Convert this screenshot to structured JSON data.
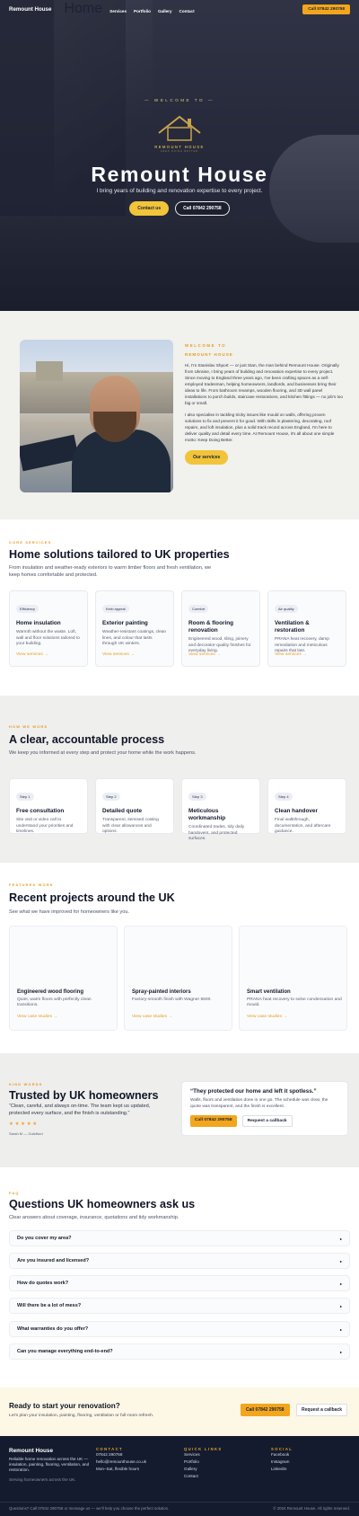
{
  "nav": {
    "brand": "Remount House",
    "links": [
      "Home",
      "Services",
      "Portfolio",
      "Gallery",
      "Contact"
    ],
    "cta": "Call 07842 290758"
  },
  "hero": {
    "kicker": "WELCOME TO",
    "logo_text": "REMOUNT HOUSE",
    "logo_tag": "KEEP DOING BETTER",
    "title": "Remount House",
    "subtitle": "I bring years of building and renovation expertise to every project.",
    "btn_primary": "Contact us",
    "btn_secondary": "Call 07842 290758"
  },
  "about": {
    "kicker": "WELCOME TO",
    "name": "REMOUNT HOUSE",
    "p1": "Hi, I'm Stanislav Shport — or just Stan, the man behind Remount House. Originally from Ukraine, I bring years of building and renovation expertise to every project. Since moving to England three years ago, I've been crafting spaces as a self-employed tradesman, helping homeowners, landlords, and businesses bring their ideas to life. From bathroom revamps, wooden flooring, and 3D wall panel installations to porch builds, staircase restorations, and kitchen fittings — no job's too big or small.",
    "p2": "I also specialise in tackling tricky issues like mould on walls, offering proven solutions to fix and prevent it for good. With skills in plastering, decorating, roof repairs, and loft insulation, plus a solid track record across England, I'm here to deliver quality and detail every time. At Remount House, it's all about one simple motto: Keep Doing Better.",
    "button": "Our services"
  },
  "services": {
    "kicker": "CORE SERVICES",
    "title": "Home solutions tailored to UK properties",
    "desc": "From insulation and weather-ready exteriors to warm timber floors and fresh ventilation, we keep homes comfortable and protected.",
    "items": [
      {
        "tag": "Efficiency",
        "title": "Home insulation",
        "desc": "Warmth without the waste. Loft, wall and floor solutions tailored to your building.",
        "link": "View services →"
      },
      {
        "tag": "Kerb appeal",
        "title": "Exterior painting",
        "desc": "Weather-resistant coatings, clean lines, and colour that lasts through UK winters.",
        "link": "View services →"
      },
      {
        "tag": "Comfort",
        "title": "Room & flooring renovation",
        "desc": "Engineered wood, tiling, joinery and decorator-quality finishes for everyday living.",
        "link": "View services →"
      },
      {
        "tag": "Air quality",
        "title": "Ventilation & restoration",
        "desc": "PRANA heat recovery, damp remediation and meticulous repairs that last.",
        "link": "View services →"
      }
    ]
  },
  "process": {
    "kicker": "HOW WE WORK",
    "title": "A clear, accountable process",
    "desc": "We keep you informed at every step and protect your home while the work happens.",
    "steps": [
      {
        "tag": "Step 1",
        "title": "Free consultation",
        "desc": "Site visit or video call to understand your priorities and timelines."
      },
      {
        "tag": "Step 2",
        "title": "Detailed quote",
        "desc": "Transparent, itemised costing with clear allowances and options."
      },
      {
        "tag": "Step 3",
        "title": "Meticulous workmanship",
        "desc": "Coordinated trades, tidy daily handovers, and protected surfaces."
      },
      {
        "tag": "Step 4",
        "title": "Clean handover",
        "desc": "Final walkthrough, documentation, and aftercare guidance."
      }
    ]
  },
  "projects": {
    "kicker": "FEATURED WORK",
    "title": "Recent projects around the UK",
    "desc": "See what we have improved for homeowners like you.",
    "items": [
      {
        "title": "Engineered wood flooring",
        "desc": "Quiet, warm floors with perfectly clean transitions.",
        "link": "View case studies →"
      },
      {
        "title": "Spray-painted interiors",
        "desc": "Factory-smooth finish with Wagner 5500.",
        "link": "View case studies →"
      },
      {
        "title": "Smart ventilation",
        "desc": "PRANA heat recovery to solve condensation and mould.",
        "link": "View case studies →"
      }
    ]
  },
  "testimonial": {
    "kicker": "KIND WORDS",
    "title": "Trusted by UK homeowners",
    "quote": "“Clean, careful, and always on-time. The team kept us updated, protected every surface, and the finish is outstanding.”",
    "stars": "★ ★ ★ ★ ★",
    "author": "Sarah M — Guildford",
    "card_title": "“They protected our home and left it spotless.”",
    "card_text": "Walls, floors and ventilation done in one go. The schedule was clear, the quote was transparent, and the finish is excellent.",
    "card_btn1": "Call 07842 290758",
    "card_btn2": "Request a callback"
  },
  "faq": {
    "kicker": "FAQ",
    "title": "Questions UK homeowners ask us",
    "desc": "Clear answers about coverage, insurance, quotations and tidy workmanship.",
    "items": [
      "Do you cover my area?",
      "Are you insured and licensed?",
      "How do quotes work?",
      "Will there be a lot of mess?",
      "What warranties do you offer?",
      "Can you manage everything end-to-end?"
    ],
    "toggle": "▸"
  },
  "ready": {
    "title": "Ready to start your renovation?",
    "desc": "Let's plan your insulation, painting, flooring, ventilation or full-room refresh.",
    "btn1": "Call 07842 290758",
    "btn2": "Request a callback"
  },
  "footer": {
    "brand": "Remount House",
    "about": "Reliable home renovation across the UK — insulation, painting, flooring, ventilation, and restoration.",
    "serving": "Serving homeowners across the UK.",
    "contact_h": "CONTACT",
    "contact": [
      "07842 290758",
      "hello@remounthouse.co.uk",
      "Mon–Sat, flexible hours"
    ],
    "quick_h": "QUICK LINKS",
    "quick": [
      "Services",
      "Portfolio",
      "Gallery",
      "Contact"
    ],
    "social_h": "SOCIAL",
    "social": [
      "Facebook",
      "Instagram",
      "LinkedIn"
    ],
    "bottom_left": "Questions? Call 07842 290758 or message us — we'll help you choose the perfect solution.",
    "bottom_right": "© 2024 Remount House. All rights reserved."
  },
  "colors": {
    "accent": "#f2a61d",
    "accent_text": "#e69a1c",
    "footer_bg": "#141b2e",
    "hero_bg": "#2b2e3f"
  }
}
